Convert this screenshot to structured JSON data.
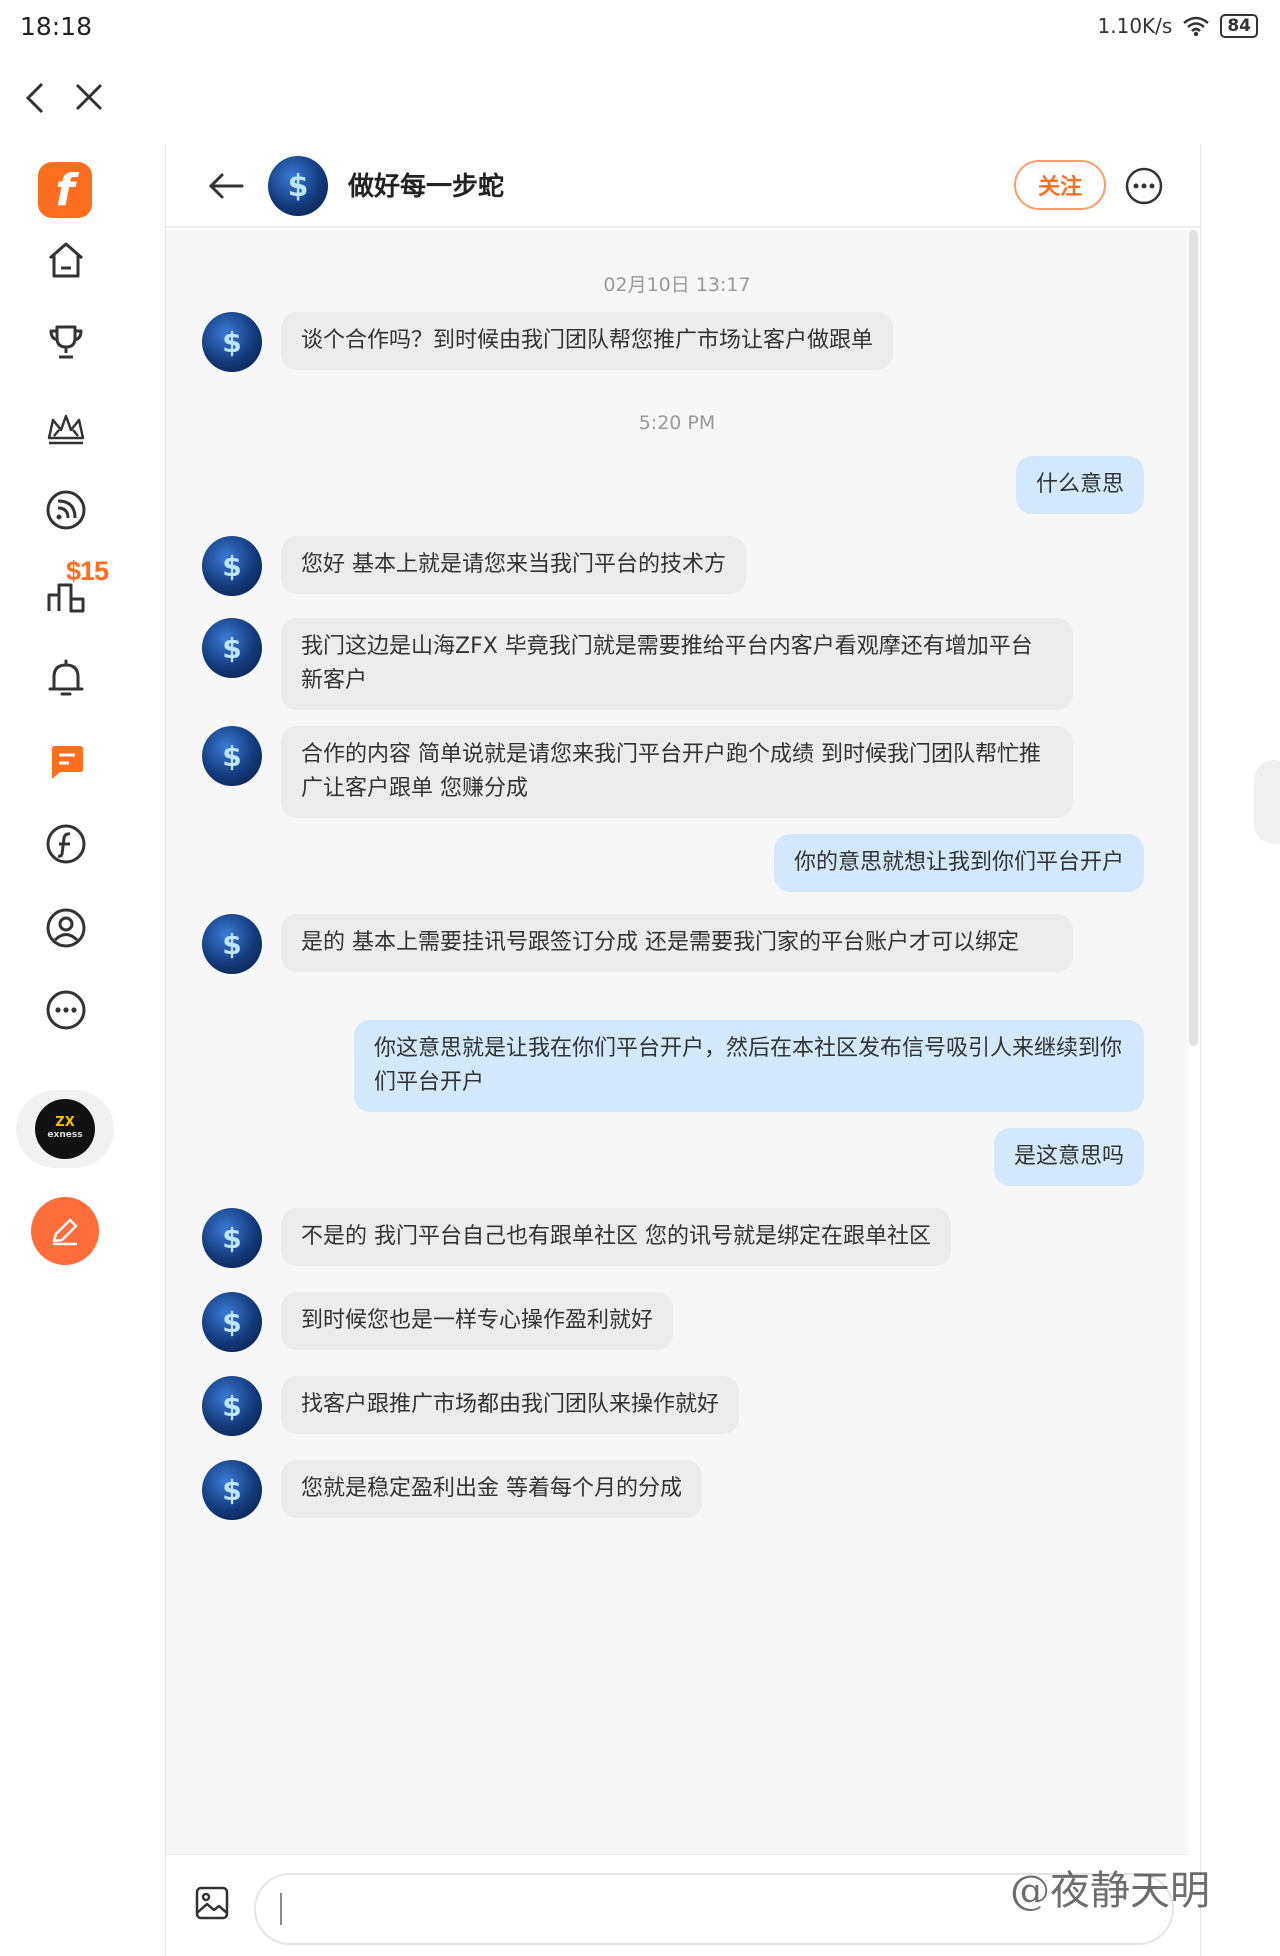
{
  "status_bar": {
    "time": "18:18",
    "network_speed": "1.10K/s",
    "battery": "84"
  },
  "sidebar": {
    "badge": "$15",
    "sponsor_text_1": "ZX",
    "sponsor_text_2": "exness",
    "items": [
      "home-icon",
      "trophy-icon",
      "crown-icon",
      "feed-icon",
      "ranking-icon",
      "bell-icon",
      "messages-icon",
      "coin-icon",
      "profile-icon",
      "more-icon"
    ]
  },
  "chat": {
    "contact_name": "做好每一步蛇",
    "avatar_symbol": "$",
    "follow_label": "关注",
    "timestamps": [
      "02月10日 13:17",
      "5:20 PM"
    ],
    "messages": [
      {
        "dir": "in",
        "text": "谈个合作吗？到时候由我门团队帮您推广市场让客户做跟单"
      },
      {
        "dir": "out",
        "text": "什么意思"
      },
      {
        "dir": "in",
        "text": "您好 基本上就是请您来当我门平台的技术方"
      },
      {
        "dir": "in",
        "text": "我门这边是山海ZFX 毕竟我门就是需要推给平台内客户看观摩还有增加平台新客户"
      },
      {
        "dir": "in",
        "text": "合作的内容 简单说就是请您来我门平台开户跑个成绩 到时候我门团队帮忙推广让客户跟单 您赚分成"
      },
      {
        "dir": "out",
        "text": "你的意思就想让我到你们平台开户"
      },
      {
        "dir": "in",
        "text": "是的 基本上需要挂讯号跟签订分成 还是需要我门家的平台账户才可以绑定"
      },
      {
        "dir": "out",
        "text": "你这意思就是让我在你们平台开户，然后在本社区发布信号吸引人来继续到你们平台开户"
      },
      {
        "dir": "out",
        "text": "是这意思吗"
      },
      {
        "dir": "in",
        "text": "不是的 我门平台自己也有跟单社区 您的讯号就是绑定在跟单社区"
      },
      {
        "dir": "in",
        "text": "到时候您也是一样专心操作盈利就好"
      },
      {
        "dir": "in",
        "text": "找客户跟推广市场都由我门团队来操作就好"
      },
      {
        "dir": "in",
        "text": "您就是稳定盈利出金 等着每个月的分成"
      }
    ],
    "input_value": ""
  },
  "watermark": "@夜静天明"
}
